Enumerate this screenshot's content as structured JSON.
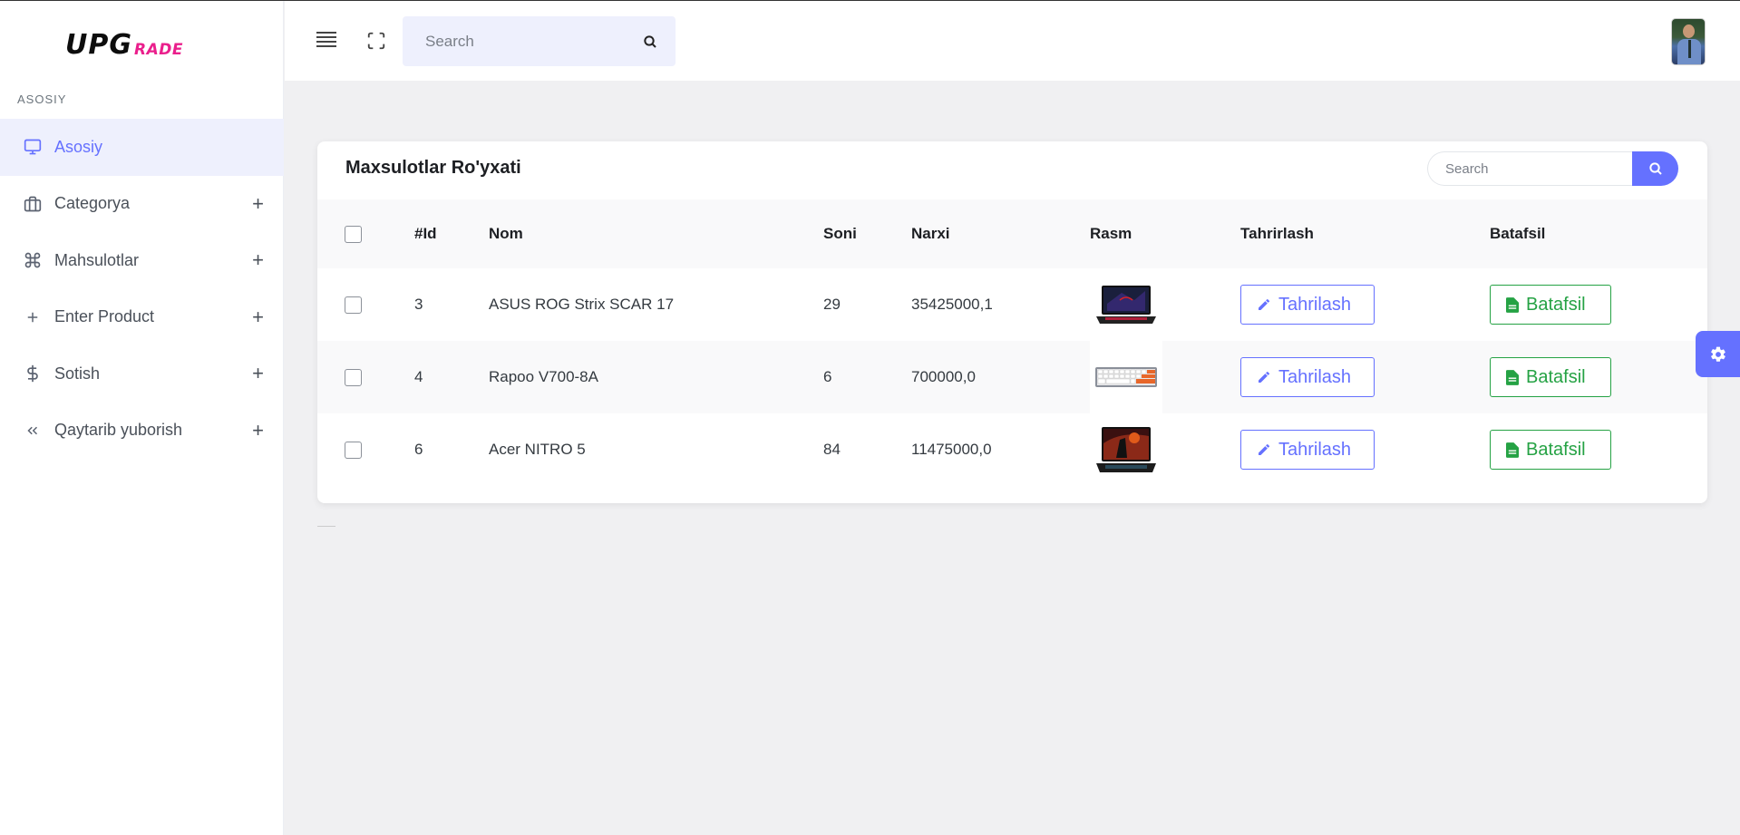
{
  "logo": {
    "part1": "UPG",
    "part2": "RADE"
  },
  "sidebar": {
    "section": "ASOSIY",
    "items": [
      {
        "label": "Asosiy",
        "icon": "monitor-icon",
        "active": true
      },
      {
        "label": "Categorya",
        "icon": "briefcase-icon",
        "expand": "+"
      },
      {
        "label": "Mahsulotlar",
        "icon": "command-icon",
        "expand": "+"
      },
      {
        "label": "Enter Product",
        "icon": "plus-icon",
        "expand": "+"
      },
      {
        "label": "Sotish",
        "icon": "dollar-icon",
        "expand": "+"
      },
      {
        "label": "Qaytarib yuborish",
        "icon": "chevrons-left-icon",
        "expand": "+"
      }
    ]
  },
  "topbar": {
    "search_placeholder": "Search"
  },
  "card": {
    "title": "Maxsulotlar Ro'yxati",
    "search_placeholder": "Search",
    "columns": {
      "id": "#Id",
      "nom": "Nom",
      "soni": "Soni",
      "narxi": "Narxi",
      "rasm": "Rasm",
      "tahrirlash": "Tahrirlash",
      "batafsil": "Batafsil"
    },
    "rows": [
      {
        "id": "3",
        "nom": "ASUS ROG Strix SCAR 17",
        "soni": "29",
        "narxi": "35425000,1",
        "image": "laptop-rog-image",
        "edit": "Tahrilash",
        "more": "Batafsil"
      },
      {
        "id": "4",
        "nom": "Rapoo V700-8A",
        "soni": "6",
        "narxi": "700000,0",
        "image": "keyboard-image",
        "edit": "Tahrilash",
        "more": "Batafsil"
      },
      {
        "id": "6",
        "nom": "Acer NITRO 5",
        "soni": "84",
        "narxi": "11475000,0",
        "image": "laptop-nitro-image",
        "edit": "Tahrilash",
        "more": "Batafsil"
      }
    ]
  },
  "colors": {
    "accent": "#6571ff",
    "success": "#25a244",
    "brand_pink": "#ea1f8c"
  }
}
